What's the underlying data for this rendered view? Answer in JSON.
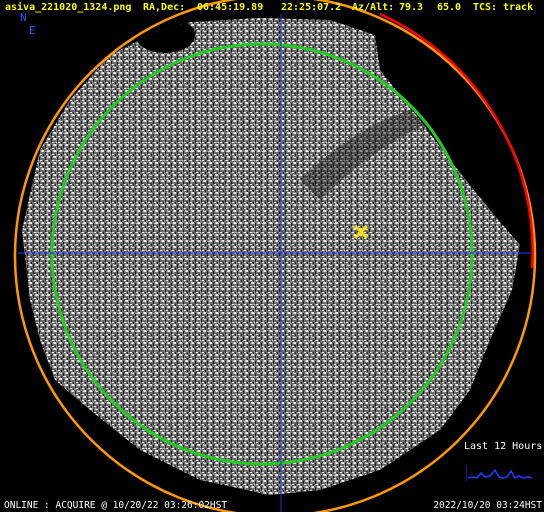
{
  "header": {
    "filename": "asiva_221020_1324.png",
    "radec_label": "RA,Dec:",
    "ra": "06:45:19.89",
    "dec": "22:25:07.2",
    "azalt_label": "Az/Alt:",
    "az": "79.3",
    "alt": "65.0",
    "tcs_label": "TCS:",
    "tcs_status": "track"
  },
  "compass": {
    "north": "N",
    "east": "E"
  },
  "status_footer": {
    "left": "ONLINE : ACQUIRE @ 10/20/22 03:26:02HST",
    "right": "2022/10/20 03:24HST"
  },
  "history_panel": {
    "label": "Last 12 Hours"
  },
  "colors": {
    "header_text": "#ffff00",
    "horizon_ring": "#ff9900",
    "limit_arc": "#ff0000",
    "elevation_circle": "#22cc22",
    "crosshair": "#1a2dcc",
    "target_marker": "#ffdd00",
    "compass": "#2a5cff"
  },
  "icons": {
    "target": "x-marker-icon",
    "compass": "compass-rose-icon"
  }
}
